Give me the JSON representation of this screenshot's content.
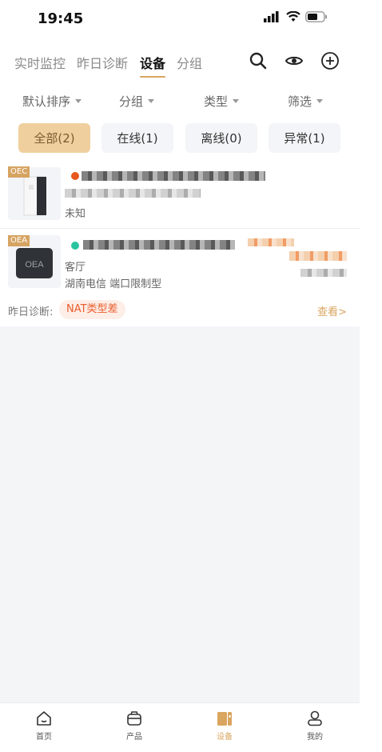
{
  "status_bar": {
    "time": "19:45"
  },
  "top_tabs": [
    {
      "label": "实时监控",
      "active": false
    },
    {
      "label": "昨日诊断",
      "active": false
    },
    {
      "label": "设备",
      "active": true
    },
    {
      "label": "分组",
      "active": false
    }
  ],
  "top_icons": [
    "search-icon",
    "eye-icon",
    "add-circle-icon"
  ],
  "filters": [
    {
      "label": "默认排序"
    },
    {
      "label": "分组"
    },
    {
      "label": "类型"
    },
    {
      "label": "筛选"
    }
  ],
  "status_chips": [
    {
      "label": "全部(2)",
      "active": true
    },
    {
      "label": "在线(1)",
      "active": false
    },
    {
      "label": "离线(0)",
      "active": false
    },
    {
      "label": "异常(1)",
      "active": false
    }
  ],
  "devices": [
    {
      "tag": "OEC",
      "status_dot_color": "#e8571e",
      "line3": "未知"
    },
    {
      "tag": "OEA",
      "status_dot_color": "#2bc4a0",
      "location": "客厅",
      "network": "湖南电信  端口限制型",
      "diagnosis_label": "昨日诊断:",
      "diagnosis_badge": "NAT类型差",
      "view_link": "查看>"
    }
  ],
  "bottom_nav": [
    {
      "label": "首页",
      "icon": "home-icon",
      "active": false
    },
    {
      "label": "产品",
      "icon": "product-box-icon",
      "active": false
    },
    {
      "label": "设备",
      "icon": "device-icon",
      "active": true
    },
    {
      "label": "我的",
      "icon": "profile-icon",
      "active": false
    }
  ],
  "colors": {
    "accent": "#d9a55f",
    "chip_active_bg": "#f0cf9e",
    "warning": "#ea5d2c",
    "online": "#2bc4a0",
    "offline_dot": "#e8571e"
  }
}
